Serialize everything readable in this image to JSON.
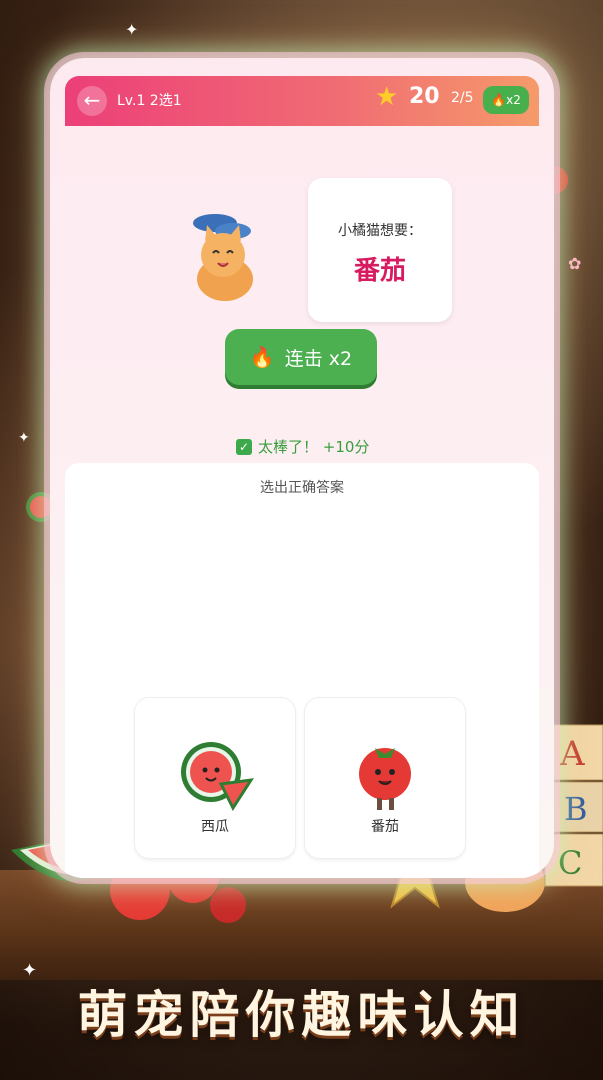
{
  "header": {
    "back_icon": "←",
    "level": "Lv.1 2选1",
    "score": "20",
    "progress": "2/5",
    "combo_chip": "x2"
  },
  "speech": {
    "prompt": "小橘猫想要：",
    "target": "番茄"
  },
  "combo_button": {
    "label": "连击 x2"
  },
  "feedback": {
    "text": "太棒了！ +10分"
  },
  "answers": {
    "instruction": "选出正确答案",
    "options": [
      {
        "label": "西瓜"
      },
      {
        "label": "番茄"
      }
    ]
  },
  "banner": {
    "text": "萌宠陪你趣味认知"
  },
  "colors": {
    "header_start": "#ec3f78",
    "accent_green": "#4caf50",
    "target_text": "#d81b60"
  }
}
